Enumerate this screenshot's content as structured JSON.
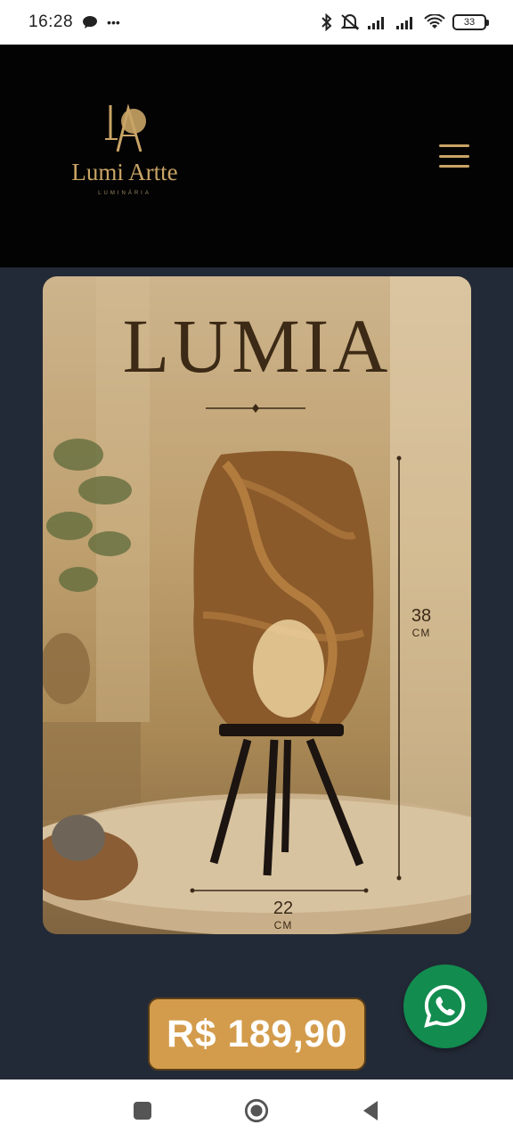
{
  "status_bar": {
    "time": "16:28",
    "notif_dots": "•••",
    "battery": "33",
    "icons": [
      "chat-bubble-icon",
      "bluetooth-icon",
      "mute-icon",
      "signal-icon",
      "signal-icon",
      "wifi-icon",
      "battery-icon"
    ]
  },
  "header": {
    "logo_name": "Lumi Artte",
    "logo_sub": "LUMINÁRIA",
    "menu_icon": "hamburger-icon",
    "accent": "#c9a466"
  },
  "product": {
    "title": "LUMIA",
    "height_value": "38",
    "height_unit": "CM",
    "width_value": "22",
    "width_unit": "CM",
    "price": "R$ 189,90"
  },
  "colors": {
    "price_bg": "#d39c4c",
    "whatsapp": "#128c4f",
    "page_bg": "#232a37"
  },
  "navbar": {
    "icons": [
      "recent-apps-icon",
      "home-icon",
      "back-icon"
    ]
  }
}
